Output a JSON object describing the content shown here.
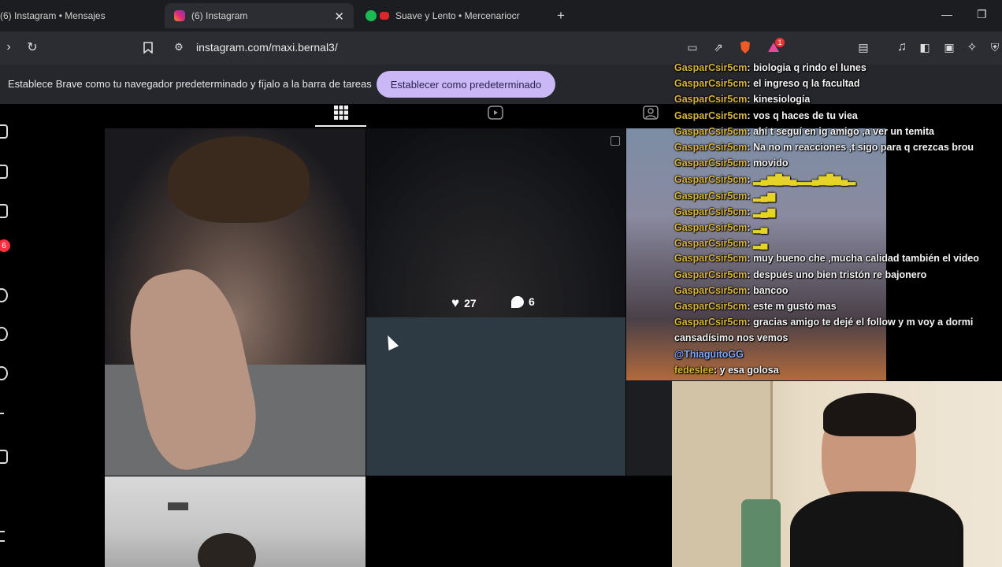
{
  "browser": {
    "tabs": [
      {
        "title": "(6) Instagram • Mensajes",
        "icon": "instagram-icon"
      },
      {
        "title": "(6) Instagram",
        "icon": "instagram-icon"
      },
      {
        "title": "Suave y Lento • Mercenariocr",
        "icon": "spotify-icon"
      }
    ],
    "new_tab": "+",
    "url": "instagram.com/maxi.bernal3/",
    "brave_badge": "1",
    "accent": "#c9b8f5"
  },
  "infobar": {
    "message": "Establece Brave como tu navegador predeterminado y fíjalo a la barra de tareas",
    "button": "Establecer como predeterminado"
  },
  "instagram": {
    "notif_badge": "6",
    "hover_stats": {
      "likes": "27",
      "comments": "6"
    }
  },
  "chat": [
    {
      "name": "GasparCsir5cm",
      "message": "biologia q rindo el lunes"
    },
    {
      "name": "GasparCsir5cm",
      "message": "el ingreso q la facultad"
    },
    {
      "name": "GasparCsir5cm",
      "message": "kinesiología"
    },
    {
      "name": "GasparCsir5cm",
      "message": "vos q haces de tu viea"
    },
    {
      "name": "GasparCsir5cm",
      "message": "ahí t seguí en ig amigo ,a ver un temita"
    },
    {
      "name": "GasparCsir5cm",
      "message": "Na no m reacciones ,t sigo para q crezcas brou"
    },
    {
      "name": "GasparCsir5cm",
      "message": "movido"
    },
    {
      "name": "GasparCsir5cm",
      "message": "▂▄▆█▆▄▂▂▄▆█▆▄▂"
    },
    {
      "name": "GasparCsir5cm",
      "message": "▂▄▆"
    },
    {
      "name": "GasparCsir5cm",
      "message": "▂▄▆"
    },
    {
      "name": "GasparCsir5cm",
      "message": "▂▄"
    },
    {
      "name": "GasparCsir5cm",
      "message": "▂▄"
    },
    {
      "name": "GasparCsir5cm",
      "message": "muy bueno che ,mucha calidad también el video"
    },
    {
      "name": "GasparCsir5cm",
      "message": "después uno bien tristón re bajonero"
    },
    {
      "name": "GasparCsir5cm",
      "message": "bancoo"
    },
    {
      "name": "GasparCsir5cm",
      "message": "este m gustó mas"
    },
    {
      "name": "GasparCsir5cm",
      "message": "gracias amigo te dejé el follow y m voy a dormi"
    },
    {
      "name": "",
      "message": "cansadísimo nos vemos"
    },
    {
      "name": "@ThiaguitoGG",
      "message": ""
    },
    {
      "name": "fedeslee",
      "message": "y esa golosa"
    }
  ]
}
